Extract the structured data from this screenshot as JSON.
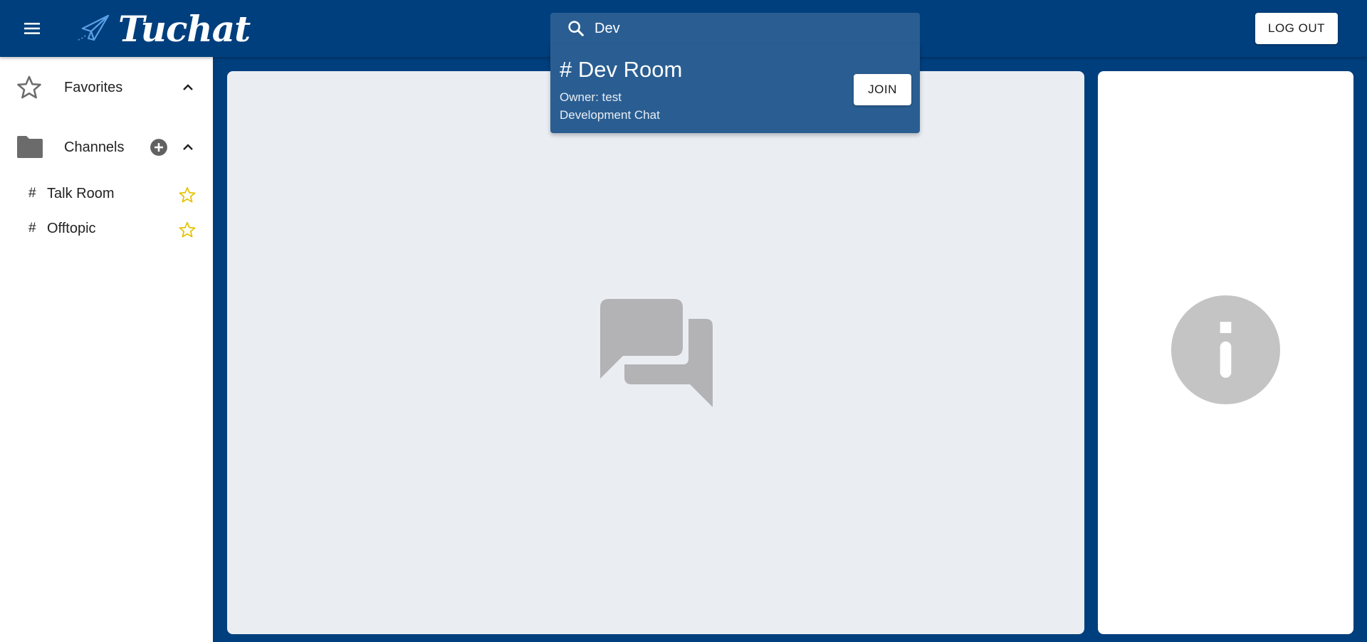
{
  "app": {
    "name": "Tuchat"
  },
  "header": {
    "search": {
      "value": "Dev"
    },
    "logout_label": "LOG OUT"
  },
  "search_results": [
    {
      "title": "# Dev Room",
      "owner": "Owner: test",
      "description": "Development Chat",
      "join_label": "JOIN"
    }
  ],
  "sidebar": {
    "favorites": {
      "label": "Favorites"
    },
    "channels": {
      "label": "Channels",
      "items": [
        {
          "hash": "#",
          "name": "Talk Room"
        },
        {
          "hash": "#",
          "name": "Offtopic"
        }
      ]
    }
  },
  "colors": {
    "brand": "#003f7d",
    "search_bg": "#2a5e92",
    "star": "#e6c200",
    "panel_gray": "#eaeef3",
    "placeholder_icon": "#b3b3b6"
  },
  "icons": {
    "menu": "menu-icon",
    "logo": "paper-plane-icon",
    "search": "search-icon",
    "favorites": "star-outline-icon",
    "channels": "folder-icon",
    "add": "add-circle-icon",
    "collapse": "chevron-up-icon",
    "favorite_toggle": "star-outline-icon",
    "chat_empty": "forum-icon",
    "info": "info-icon"
  }
}
